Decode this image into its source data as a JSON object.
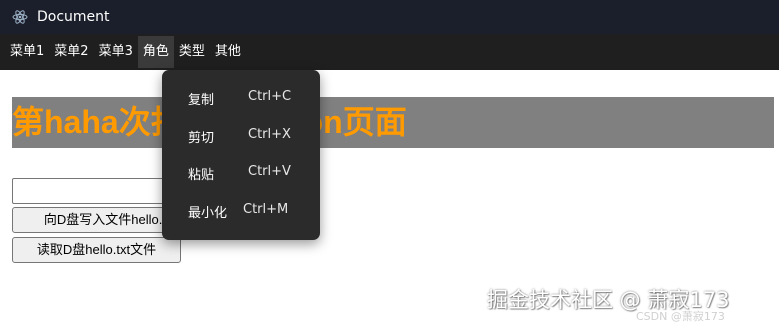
{
  "window": {
    "title": "Document",
    "app_icon": "electron-logo-icon"
  },
  "menubar": {
    "items": [
      "菜单1",
      "菜单2",
      "菜单3",
      "角色",
      "类型",
      "其他"
    ],
    "active_index": 3
  },
  "page": {
    "heading": "第haha次打开Electron页面",
    "heading_color": "#ff9b00",
    "heading_bg": "#808080",
    "input_value": "",
    "write_button": "向D盘写入文件hello.txt",
    "read_button": "读取D盘hello.txt文件"
  },
  "context_menu": {
    "items": [
      {
        "label": "复制",
        "accelerator": "Ctrl+C"
      },
      {
        "label": "剪切",
        "accelerator": "Ctrl+X"
      },
      {
        "label": "粘贴",
        "accelerator": "Ctrl+V"
      },
      {
        "label": "最小化",
        "accelerator": "Ctrl+M"
      }
    ]
  },
  "watermark": {
    "main": "掘金技术社区 @ 萧寂173",
    "csdn": "CSDN @萧寂173"
  }
}
